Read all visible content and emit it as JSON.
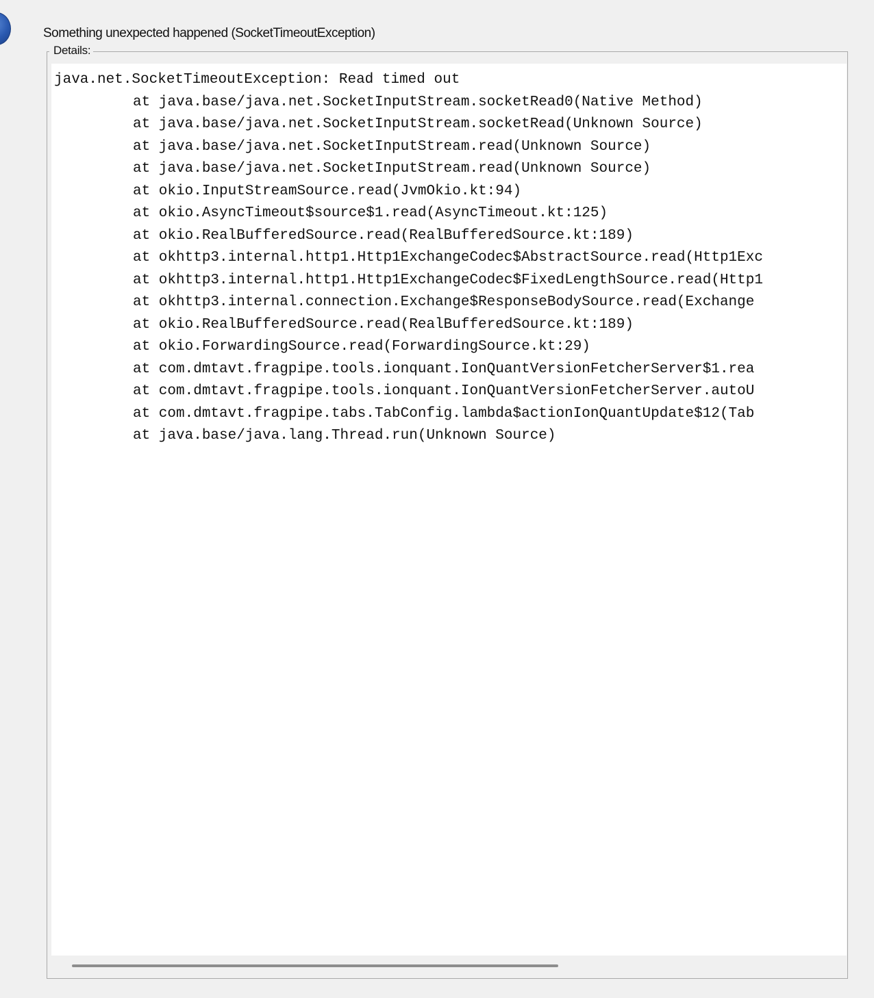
{
  "dialog": {
    "message": "Something unexpected happened (SocketTimeoutException)",
    "icon": "info-icon"
  },
  "details": {
    "label": "Details:",
    "exception": "java.net.SocketTimeoutException: Read timed out",
    "frames": [
      "at java.base/java.net.SocketInputStream.socketRead0(Native Method)",
      "at java.base/java.net.SocketInputStream.socketRead(Unknown Source)",
      "at java.base/java.net.SocketInputStream.read(Unknown Source)",
      "at java.base/java.net.SocketInputStream.read(Unknown Source)",
      "at okio.InputStreamSource.read(JvmOkio.kt:94)",
      "at okio.AsyncTimeout$source$1.read(AsyncTimeout.kt:125)",
      "at okio.RealBufferedSource.read(RealBufferedSource.kt:189)",
      "at okhttp3.internal.http1.Http1ExchangeCodec$AbstractSource.read(Http1Exc",
      "at okhttp3.internal.http1.Http1ExchangeCodec$FixedLengthSource.read(Http1",
      "at okhttp3.internal.connection.Exchange$ResponseBodySource.read(Exchange",
      "at okio.RealBufferedSource.read(RealBufferedSource.kt:189)",
      "at okio.ForwardingSource.read(ForwardingSource.kt:29)",
      "at com.dmtavt.fragpipe.tools.ionquant.IonQuantVersionFetcherServer$1.rea",
      "at com.dmtavt.fragpipe.tools.ionquant.IonQuantVersionFetcherServer.autoU",
      "at com.dmtavt.fragpipe.tabs.TabConfig.lambda$actionIonQuantUpdate$12(Tab",
      "at java.base/java.lang.Thread.run(Unknown Source)"
    ]
  },
  "colors": {
    "window_bg": "#f0f0f0",
    "text_area_bg": "#ffffff",
    "border": "#a9a9a9",
    "scroll_thumb": "#8d8d8d"
  }
}
